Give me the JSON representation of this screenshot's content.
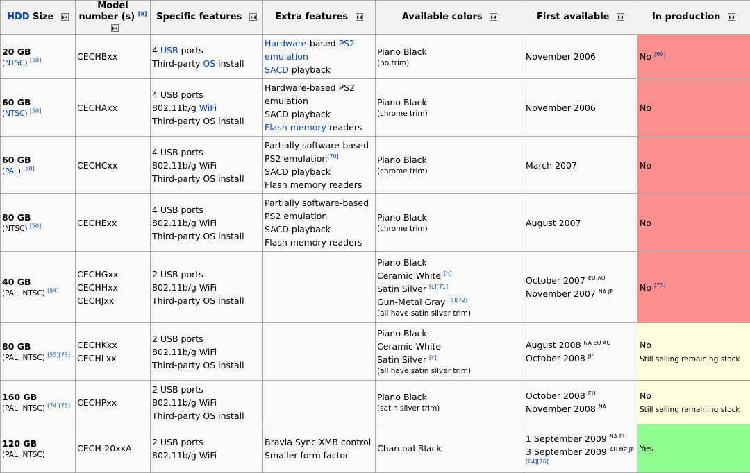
{
  "header": {
    "hdd_link": "HDD",
    "hdd_rest": "Size",
    "model": "Model number (s)",
    "model_ref": "[a]",
    "specific": "Specific features",
    "extra": "Extra features",
    "colors": "Available colors",
    "first": "First available",
    "production": "In production"
  },
  "rows": [
    {
      "size": "20 GB",
      "region_link": "NTSC",
      "region_ref": "[50]",
      "model": [
        "CECHBxx"
      ],
      "specific": [
        {
          "t1": "4 ",
          "link": "USB",
          "t2": " ports"
        },
        {
          "t1": "Third-party ",
          "link": "OS",
          "t2": " install"
        }
      ],
      "extra": [
        {
          "t1": "",
          "link": "Hardware",
          "t2": "-based ",
          "link2": "PS2"
        },
        {
          "t1": "",
          "link": "emulation",
          "t2": ""
        },
        {
          "t1": "",
          "link": "SACD",
          "t2": " playback"
        }
      ],
      "colors": [
        "Piano Black"
      ],
      "color_note": "(no trim)",
      "first": [
        "November 2006"
      ],
      "prod": "No",
      "prod_ref": "[69]"
    },
    {
      "size": "60 GB",
      "region_link": "NTSC",
      "region_ref": "[50]",
      "model": [
        "CECHAxx"
      ],
      "specific": [
        {
          "t1": "4 USB ports",
          "link": "",
          "t2": ""
        },
        {
          "t1": "802.11b/g ",
          "link": "WiFi",
          "t2": ""
        },
        {
          "t1": "Third-party OS install",
          "link": "",
          "t2": ""
        }
      ],
      "extra": [
        {
          "t1": "Hardware-based PS2",
          "link": "",
          "t2": ""
        },
        {
          "t1": "emulation",
          "link": "",
          "t2": ""
        },
        {
          "t1": "SACD playback",
          "link": "",
          "t2": ""
        },
        {
          "t1": "",
          "link": "Flash memory",
          "t2": " readers"
        }
      ],
      "colors": [
        "Piano Black"
      ],
      "color_note": "(chrome trim)",
      "first": [
        "November 2006"
      ],
      "prod": "No"
    },
    {
      "size": "60 GB",
      "region_link": "PAL",
      "region_ref": "[50]",
      "model": [
        "CECHCxx"
      ],
      "specific": [
        {
          "t1": "4 USB ports",
          "link": "",
          "t2": ""
        },
        {
          "t1": "802.11b/g WiFi",
          "link": "",
          "t2": ""
        },
        {
          "t1": "Third-party OS install",
          "link": "",
          "t2": ""
        }
      ],
      "extra": [
        {
          "t1": "Partially software-based",
          "link": "",
          "t2": ""
        },
        {
          "t1": "PS2 emulation",
          "link": "",
          "t2": "",
          "ref": "[70]"
        },
        {
          "t1": "SACD playback",
          "link": "",
          "t2": ""
        },
        {
          "t1": "Flash memory readers",
          "link": "",
          "t2": ""
        }
      ],
      "colors": [
        "Piano Black"
      ],
      "color_note": "(chrome trim)",
      "first": [
        "March 2007"
      ],
      "prod": "No"
    },
    {
      "size": "80 GB",
      "region_text": "(NTSC)",
      "region_ref": "[50]",
      "model": [
        "CECHExx"
      ],
      "specific": [
        {
          "t1": "4 USB ports",
          "link": "",
          "t2": ""
        },
        {
          "t1": "802.11b/g WiFi",
          "link": "",
          "t2": ""
        },
        {
          "t1": "Third-party OS install",
          "link": "",
          "t2": ""
        }
      ],
      "extra": [
        {
          "t1": "Partially software-based",
          "link": "",
          "t2": ""
        },
        {
          "t1": "PS2 emulation",
          "link": "",
          "t2": ""
        },
        {
          "t1": "SACD playback",
          "link": "",
          "t2": ""
        },
        {
          "t1": "Flash memory readers",
          "link": "",
          "t2": ""
        }
      ],
      "colors": [
        "Piano Black"
      ],
      "color_note": "(chrome trim)",
      "first": [
        "August 2007"
      ],
      "prod": "No"
    },
    {
      "size": "40 GB",
      "region_text": "(PAL, NTSC)",
      "region_ref": "[54]",
      "model": [
        "CECHGxx",
        "CECHHxx",
        "CECHJxx"
      ],
      "specific": [
        {
          "t1": "2 USB ports",
          "link": "",
          "t2": ""
        },
        {
          "t1": "802.11b/g WiFi",
          "link": "",
          "t2": ""
        },
        {
          "t1": "Third-party OS install",
          "link": "",
          "t2": ""
        }
      ],
      "extra": [],
      "colors": [
        "Piano Black",
        "Ceramic White",
        "Satin Silver",
        "Gun-Metal Gray"
      ],
      "color_refs": [
        "",
        "[b]",
        "[c][71]",
        "[d][72]"
      ],
      "color_note": "(all have satin silver trim)",
      "first": [
        "October 2007",
        "November 2007"
      ],
      "first_sup": [
        "EU AU",
        "NA JP"
      ],
      "prod": "No",
      "prod_ref": "[73]"
    },
    {
      "size": "80 GB",
      "region_text": "(PAL, NTSC)",
      "region_ref": "[55][73]",
      "model": [
        "CECHKxx",
        "CECHLxx"
      ],
      "specific": [
        {
          "t1": "2 USB ports",
          "link": "",
          "t2": ""
        },
        {
          "t1": "802.11b/g WiFi",
          "link": "",
          "t2": ""
        },
        {
          "t1": "Third-party OS install",
          "link": "",
          "t2": ""
        }
      ],
      "extra": [],
      "colors": [
        "Piano Black",
        "Ceramic White",
        "Satin Silver"
      ],
      "color_refs": [
        "",
        "",
        "[c]"
      ],
      "color_note": "(all have satin silver trim)",
      "first": [
        "August 2008",
        "October 2008"
      ],
      "first_sup": [
        "NA EU AU",
        "JP"
      ],
      "prod": "No",
      "prod_note": "Still selling remaining stock"
    },
    {
      "size": "160 GB",
      "region_text": "(PAL, NTSC)",
      "region_ref": "[74][75]",
      "model": [
        "CECHPxx"
      ],
      "specific": [
        {
          "t1": "2 USB ports",
          "link": "",
          "t2": ""
        },
        {
          "t1": "802.11b/g WiFi",
          "link": "",
          "t2": ""
        },
        {
          "t1": "Third-party OS install",
          "link": "",
          "t2": ""
        }
      ],
      "extra": [],
      "colors": [
        "Piano Black"
      ],
      "color_note": "(satin silver trim)",
      "first": [
        "October 2008",
        "November 2008"
      ],
      "first_sup": [
        "EU",
        "NA"
      ],
      "prod": "No",
      "prod_note": "Still selling remaining stock"
    },
    {
      "size": "120 GB",
      "region_text": "(PAL, NTSC)",
      "model": [
        "CECH-20xxA"
      ],
      "specific": [
        {
          "t1": "2 USB ports",
          "link": "",
          "t2": ""
        },
        {
          "t1": "802.11b/g WiFi",
          "link": "",
          "t2": ""
        }
      ],
      "extra": [
        {
          "t1": "Bravia Sync XMB control",
          "link": "",
          "t2": ""
        },
        {
          "t1": "Smaller form factor",
          "link": "",
          "t2": ""
        }
      ],
      "colors": [
        "Charcoal Black"
      ],
      "first": [
        "1 September 2009",
        "3 September 2009"
      ],
      "first_sup": [
        "NA EU",
        "AU NZ JP"
      ],
      "first_ref": "[64][76]",
      "prod": "Yes"
    }
  ],
  "colors_map": {
    "no": "#ff8f8f",
    "partial": "#ffffdd",
    "yes": "#90ff90",
    "header_bg": "#f2f2f2",
    "link": "#0645ad"
  }
}
